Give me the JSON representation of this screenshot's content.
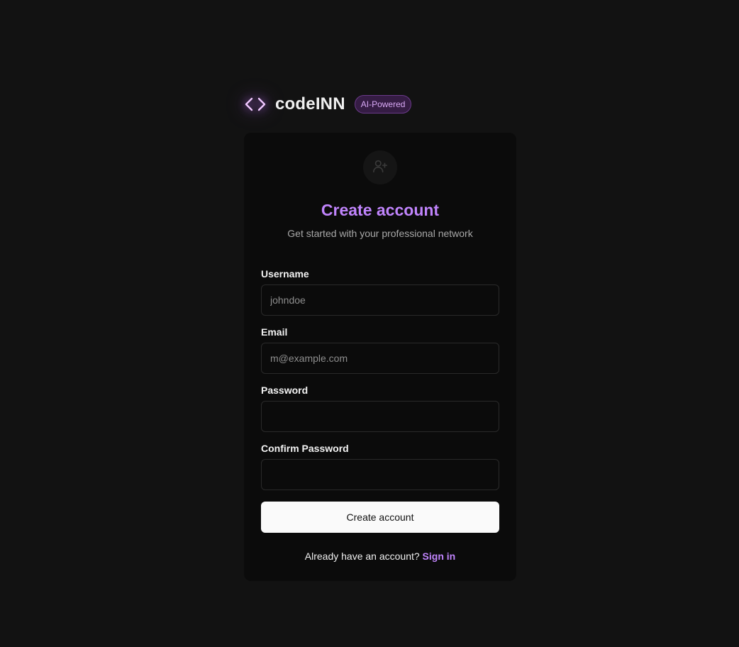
{
  "brand": {
    "name": "codeINN",
    "badge": "AI-Powered",
    "icon": "code-brackets-icon"
  },
  "card": {
    "icon": "user-plus-icon",
    "title": "Create account",
    "subtitle": "Get started with your professional network"
  },
  "form": {
    "username": {
      "label": "Username",
      "placeholder": "johndoe",
      "value": ""
    },
    "email": {
      "label": "Email",
      "placeholder": "m@example.com",
      "value": ""
    },
    "password": {
      "label": "Password",
      "placeholder": "",
      "value": ""
    },
    "confirm_password": {
      "label": "Confirm Password",
      "placeholder": "",
      "value": ""
    },
    "submit_label": "Create account"
  },
  "footer": {
    "prompt": "Already have an account?",
    "link_label": "Sign in"
  },
  "colors": {
    "background": "#121212",
    "card": "#0b0b0b",
    "accent": "#c084fc",
    "badge_bg": "#351c44"
  }
}
